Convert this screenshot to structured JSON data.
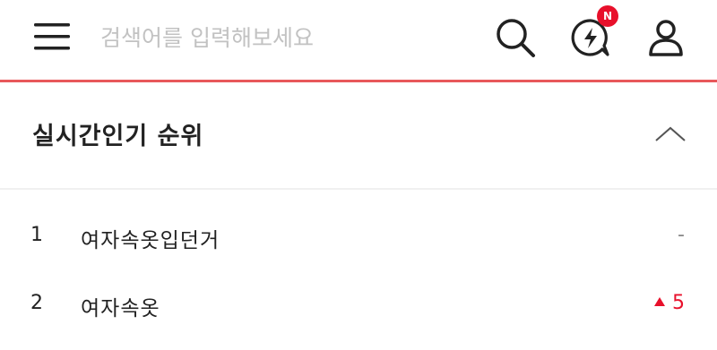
{
  "header": {
    "search_placeholder": "검색어를 입력해보세요",
    "alert_badge": "N"
  },
  "icons": {
    "menu": "menu-icon",
    "search": "search-icon",
    "alert": "alert-icon",
    "user": "user-icon",
    "collapse": "chevron-up-icon"
  },
  "colors": {
    "accent": "#e8585b",
    "badge": "#e8102b",
    "up": "#e8102b"
  },
  "ranking": {
    "title": "실시간인기 순위",
    "items": [
      {
        "rank": "1",
        "keyword": "여자속옷입던거",
        "change": "-"
      },
      {
        "rank": "2",
        "keyword": "여자속옷",
        "change": "5"
      }
    ]
  }
}
